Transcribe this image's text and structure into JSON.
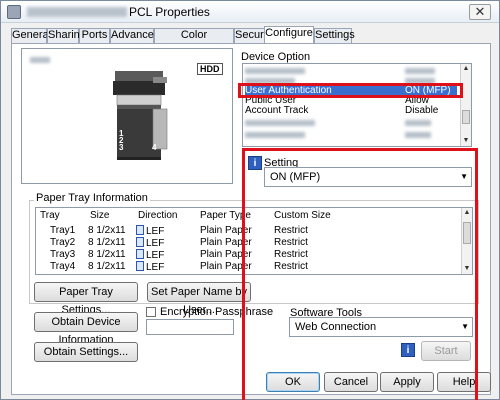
{
  "window": {
    "title": "PCL Properties",
    "close_glyph": "✕"
  },
  "tabs": [
    "General",
    "Sharing",
    "Ports",
    "Advanced",
    "Color Management",
    "Security",
    "Configure",
    "Settings"
  ],
  "active_tab": "Configure",
  "preview": {
    "hdd_badge": "HDD",
    "tray_numbers": [
      "1",
      "2",
      "3",
      "4"
    ]
  },
  "device_option": {
    "label": "Device Option",
    "rows": [
      {
        "name": "",
        "value": ""
      },
      {
        "name": "",
        "value": ""
      },
      {
        "name": "User Authentication",
        "value": "ON (MFP)",
        "selected": true
      },
      {
        "name": "Public User",
        "value": "Allow"
      },
      {
        "name": "Account Track",
        "value": "Disable"
      },
      {
        "name": "",
        "value": ""
      },
      {
        "name": "",
        "value": ""
      }
    ]
  },
  "setting": {
    "label": "Setting",
    "value": "ON (MFP)"
  },
  "paper_tray": {
    "label": "Paper Tray Information",
    "columns": [
      "Tray",
      "Size",
      "Direction",
      "Paper Type",
      "Custom Size"
    ],
    "rows": [
      [
        "Tray1",
        "8 1/2x11",
        "LEF",
        "Plain Paper",
        "Restrict"
      ],
      [
        "Tray2",
        "8 1/2x11",
        "LEF",
        "Plain Paper",
        "Restrict"
      ],
      [
        "Tray3",
        "8 1/2x11",
        "LEF",
        "Plain Paper",
        "Restrict"
      ],
      [
        "Tray4",
        "8 1/2x11",
        "LEF",
        "Plain Paper",
        "Restrict"
      ]
    ]
  },
  "buttons": {
    "paper_tray_settings": "Paper Tray Settings...",
    "set_paper_name": "Set Paper Name by User...",
    "obtain_device_info": "Obtain Device Information",
    "obtain_settings": "Obtain Settings...",
    "start": "Start",
    "ok": "OK",
    "cancel": "Cancel",
    "apply": "Apply",
    "help": "Help"
  },
  "encryption": {
    "label": "Encryption Passphrase",
    "checked": false,
    "value": ""
  },
  "software_tools": {
    "label": "Software Tools",
    "value": "Web Connection"
  },
  "colors": {
    "highlight_box": "#e0101a",
    "selection": "#3a6fd0"
  }
}
